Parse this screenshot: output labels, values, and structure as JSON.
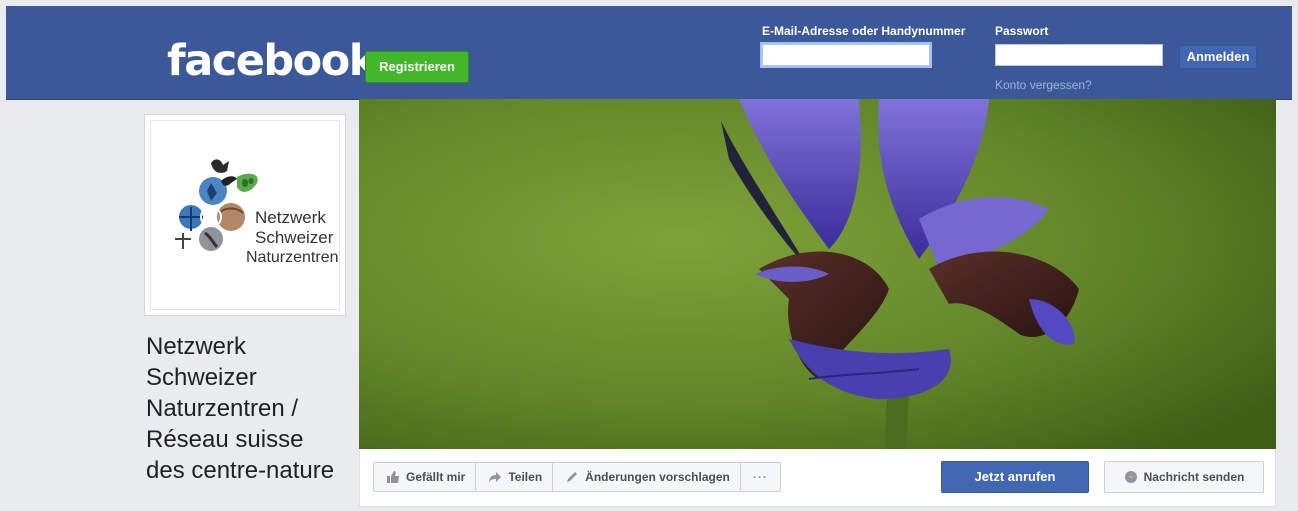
{
  "header": {
    "logo": "facebook",
    "register_label": "Registrieren",
    "email_label": "E-Mail-Adresse oder Handynummer",
    "password_label": "Passwort",
    "email_value": "",
    "password_value": "",
    "login_label": "Anmelden",
    "forgot_label": "Konto vergessen?"
  },
  "profile": {
    "logo_text_line1": "Netzwerk",
    "logo_text_line2": "Schweizer",
    "logo_text_line3": "Naturzentren",
    "page_name": "Netzwerk Schweizer Naturzentren / Réseau suisse des centre-nature"
  },
  "actions": {
    "like_label": "Gefällt mir",
    "share_label": "Teilen",
    "suggest_label": "Änderungen vorschlagen",
    "more_label": "···",
    "call_label": "Jetzt anrufen",
    "message_label": "Nachricht senden"
  },
  "colors": {
    "brand_blue": "#3b5998",
    "register_green": "#42b72a",
    "button_blue": "#4267b2"
  }
}
